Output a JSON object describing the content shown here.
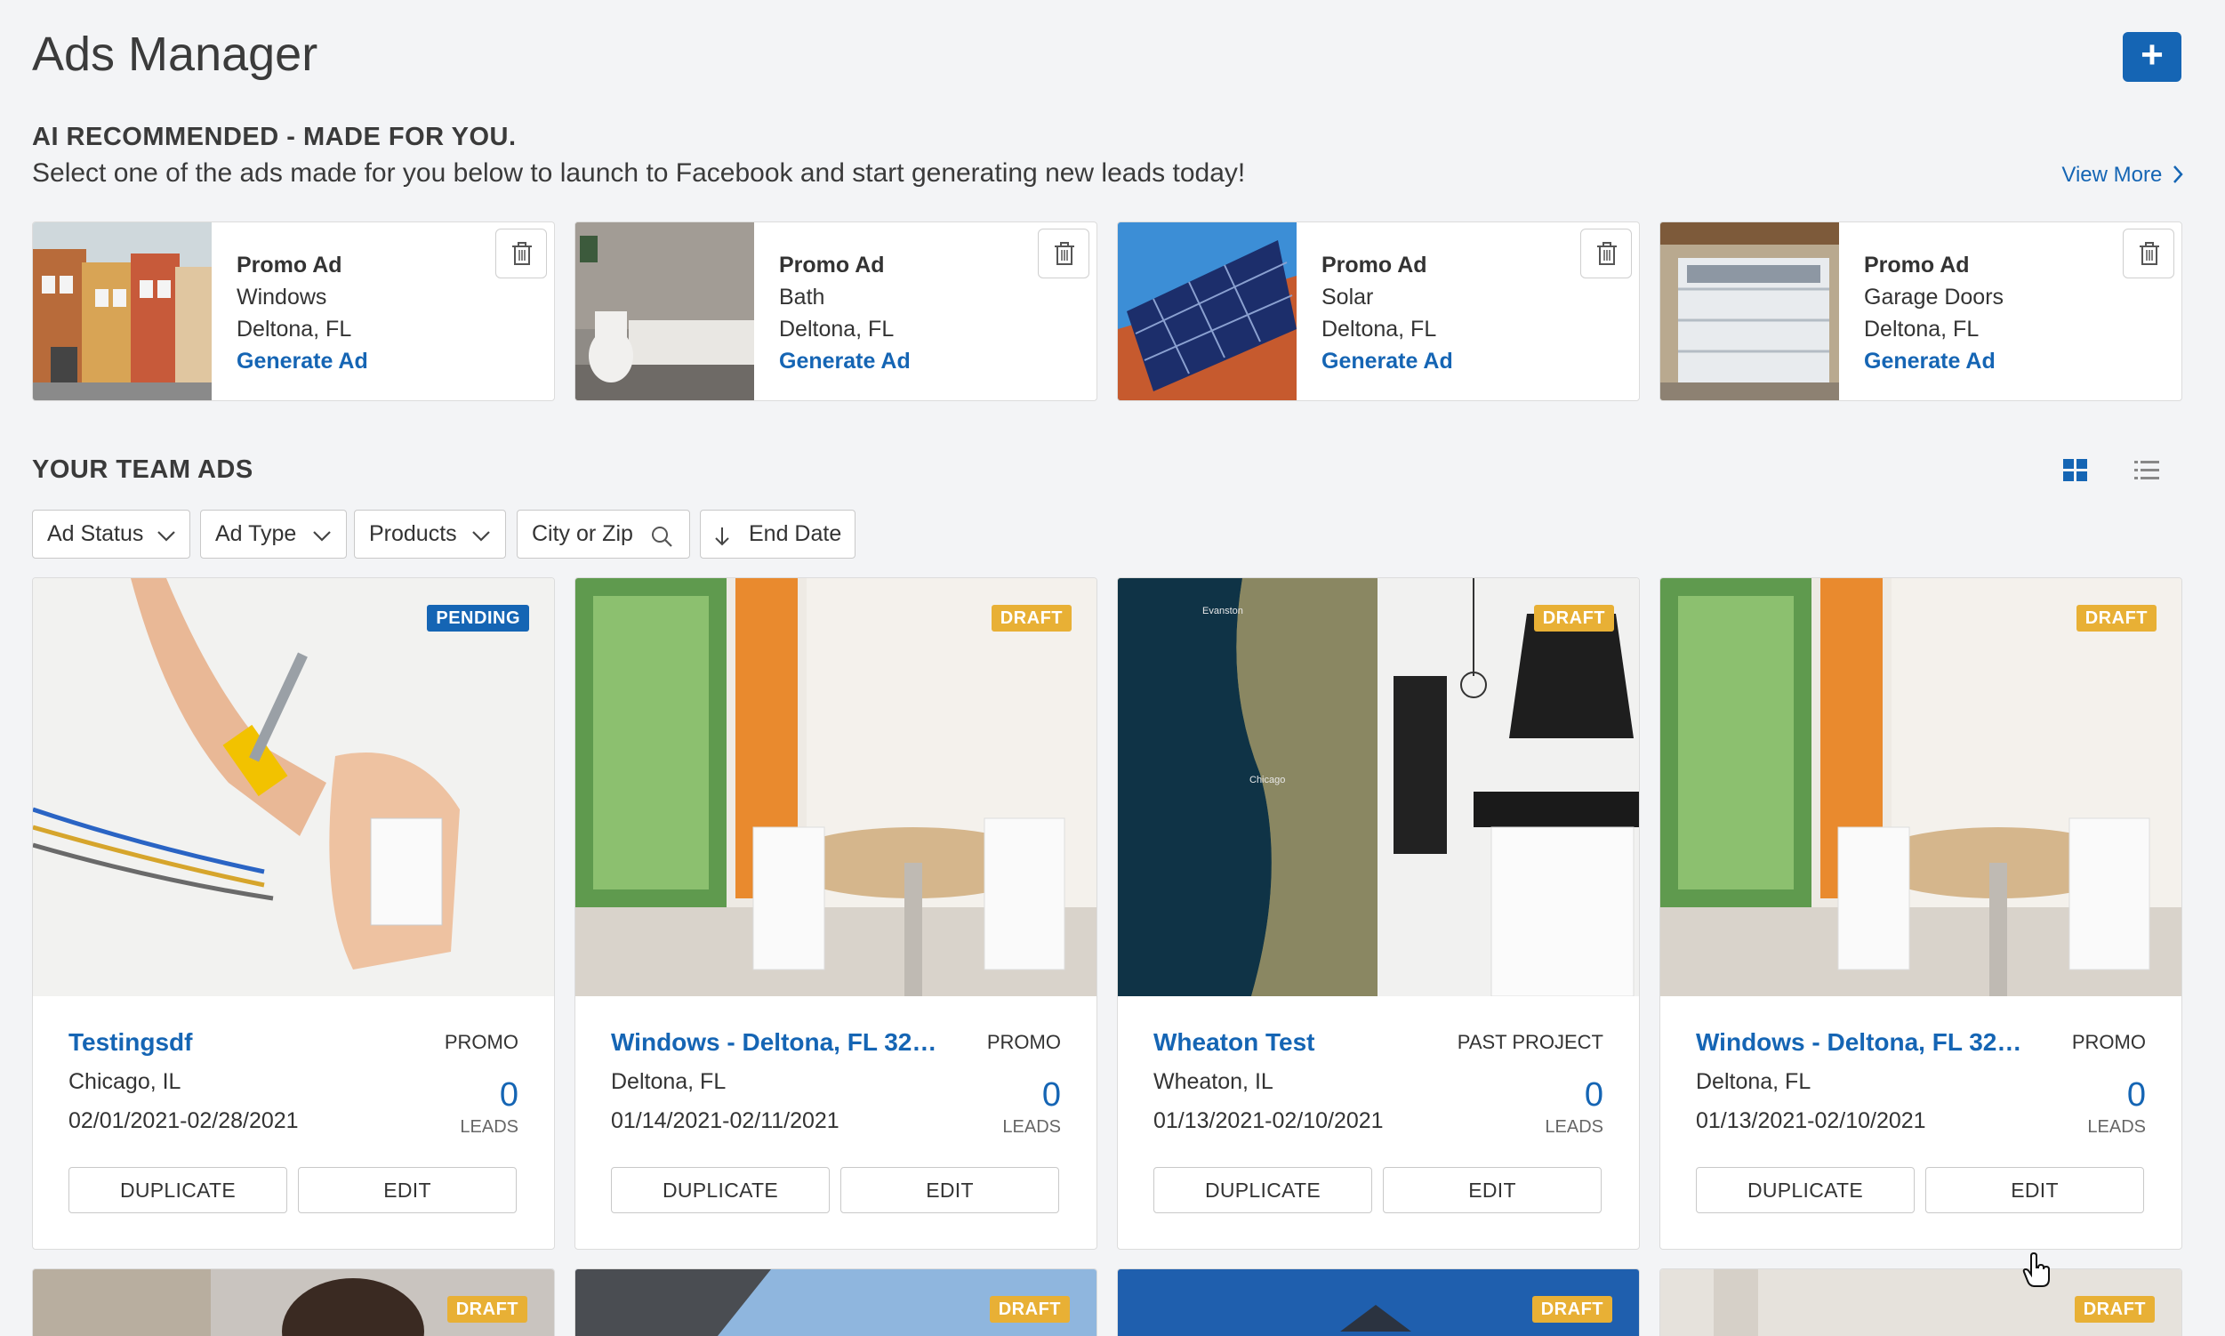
{
  "page": {
    "title": "Ads Manager",
    "add_button": "+"
  },
  "ai_section": {
    "heading": "AI RECOMMENDED - MADE FOR YOU.",
    "subtitle": "Select one of the ads made for you below to launch to Facebook and start generating new leads today!",
    "view_more": "View More"
  },
  "promos": [
    {
      "type": "Promo Ad",
      "product": "Windows",
      "location": "Deltona, FL",
      "action": "Generate Ad"
    },
    {
      "type": "Promo Ad",
      "product": "Bath",
      "location": "Deltona, FL",
      "action": "Generate Ad"
    },
    {
      "type": "Promo Ad",
      "product": "Solar",
      "location": "Deltona, FL",
      "action": "Generate Ad"
    },
    {
      "type": "Promo Ad",
      "product": "Garage Doors",
      "location": "Deltona, FL",
      "action": "Generate Ad"
    }
  ],
  "team_section": {
    "heading": "YOUR TEAM ADS"
  },
  "filters": {
    "ad_status": "Ad Status",
    "ad_type": "Ad Type",
    "products": "Products",
    "city_zip": "City or Zip",
    "end_date": "End Date"
  },
  "ads": [
    {
      "status": "PENDING",
      "title": "Testingsdf",
      "type": "PROMO",
      "location": "Chicago, IL",
      "dates": "02/01/2021-02/28/2021",
      "leads": "0",
      "leads_label": "LEADS",
      "duplicate": "DUPLICATE",
      "edit": "EDIT"
    },
    {
      "status": "DRAFT",
      "title": "Windows - Deltona, FL 327...",
      "type": "PROMO",
      "location": "Deltona, FL",
      "dates": "01/14/2021-02/11/2021",
      "leads": "0",
      "leads_label": "LEADS",
      "duplicate": "DUPLICATE",
      "edit": "EDIT"
    },
    {
      "status": "DRAFT",
      "title": "Wheaton Test",
      "type": "PAST PROJECT",
      "location": "Wheaton, IL",
      "dates": "01/13/2021-02/10/2021",
      "leads": "0",
      "leads_label": "LEADS",
      "duplicate": "DUPLICATE",
      "edit": "EDIT"
    },
    {
      "status": "DRAFT",
      "title": "Windows - Deltona, FL 327...",
      "type": "PROMO",
      "location": "Deltona, FL",
      "dates": "01/13/2021-02/10/2021",
      "leads": "0",
      "leads_label": "LEADS",
      "duplicate": "DUPLICATE",
      "edit": "EDIT"
    }
  ],
  "more_ads": [
    {
      "status": "DRAFT"
    },
    {
      "status": "DRAFT"
    },
    {
      "status": "DRAFT"
    },
    {
      "status": "DRAFT"
    }
  ],
  "map_labels": {
    "city1": "Evanston",
    "city2": "Chicago"
  },
  "colors": {
    "primary": "#1565b4",
    "draft": "#e8b035",
    "background": "#f3f4f6"
  }
}
